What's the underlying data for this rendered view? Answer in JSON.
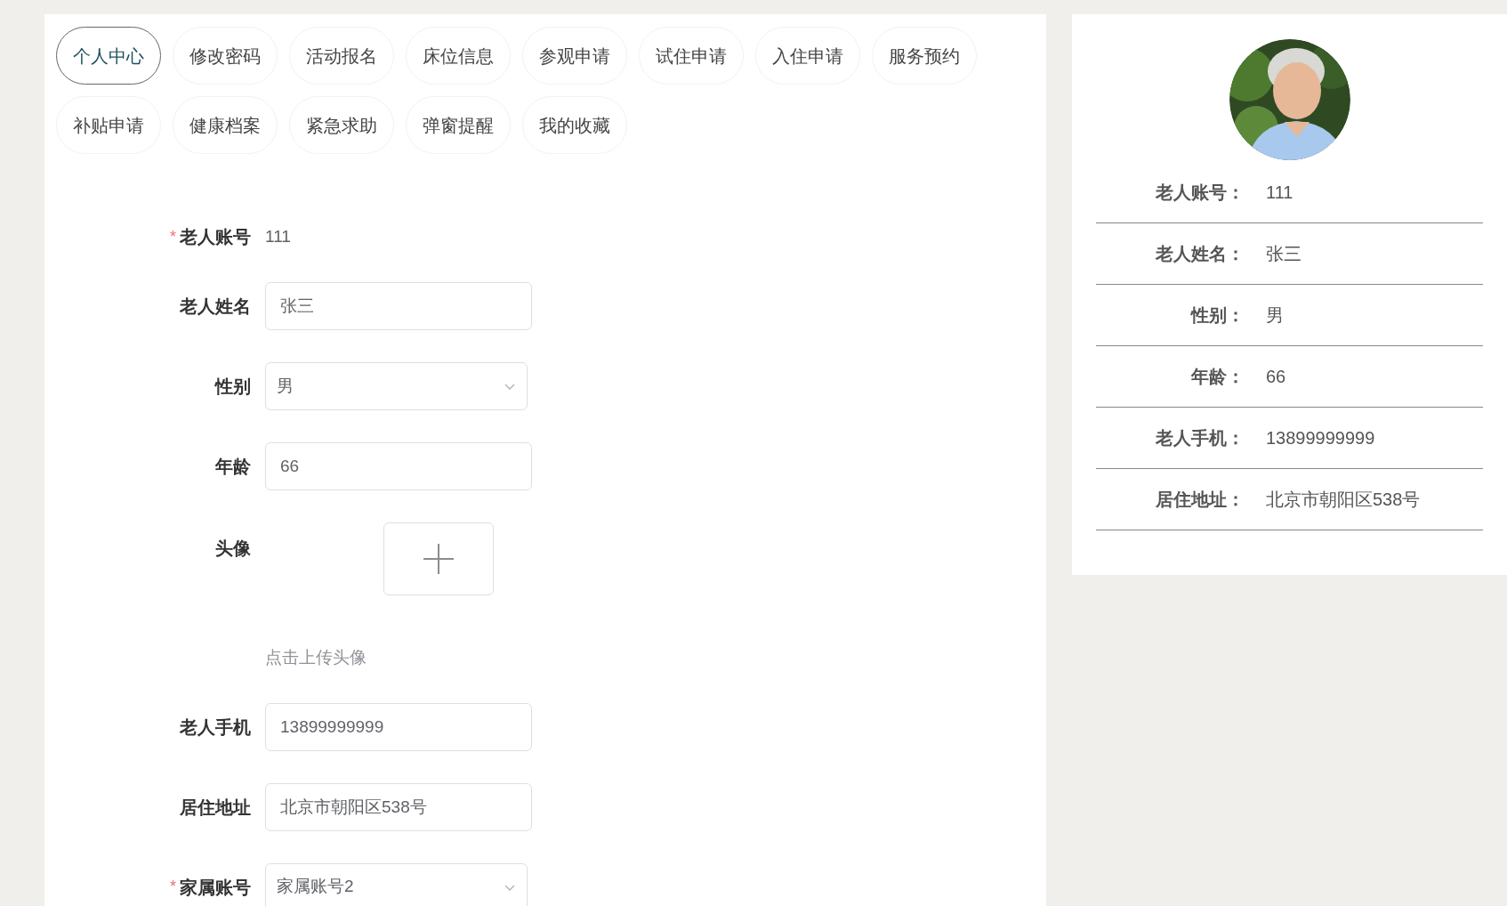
{
  "tabs": [
    {
      "label": "个人中心",
      "selected": true
    },
    {
      "label": "修改密码",
      "selected": false
    },
    {
      "label": "活动报名",
      "selected": false
    },
    {
      "label": "床位信息",
      "selected": false
    },
    {
      "label": "参观申请",
      "selected": false
    },
    {
      "label": "试住申请",
      "selected": false
    },
    {
      "label": "入住申请",
      "selected": false
    },
    {
      "label": "服务预约",
      "selected": false
    },
    {
      "label": "补贴申请",
      "selected": false
    },
    {
      "label": "健康档案",
      "selected": false
    },
    {
      "label": "紧急求助",
      "selected": false
    },
    {
      "label": "弹窗提醒",
      "selected": false
    },
    {
      "label": "我的收藏",
      "selected": false
    }
  ],
  "form": {
    "fields": [
      {
        "kind": "static",
        "label": "老人账号",
        "required_mark": "*",
        "value": "111"
      },
      {
        "kind": "input",
        "label": "老人姓名",
        "value": "张三"
      },
      {
        "kind": "select",
        "label": "性别",
        "value": "男"
      },
      {
        "kind": "input",
        "label": "年龄",
        "value": "66"
      },
      {
        "kind": "upload",
        "label": "头像",
        "hint": "点击上传头像"
      },
      {
        "kind": "input",
        "label": "老人手机",
        "value": "13899999999"
      },
      {
        "kind": "input",
        "label": "居住地址",
        "value": "北京市朝阳区538号"
      },
      {
        "kind": "select",
        "label": "家属账号",
        "required_mark": "*",
        "value": "家属账号2"
      }
    ]
  },
  "profile": {
    "rows": [
      {
        "label": "老人账号：",
        "value": "111"
      },
      {
        "label": "老人姓名：",
        "value": "张三"
      },
      {
        "label": "性别：",
        "value": "男"
      },
      {
        "label": "年龄：",
        "value": "66"
      },
      {
        "label": "老人手机：",
        "value": "13899999999"
      },
      {
        "label": "居住地址：",
        "value": "北京市朝阳区538号"
      }
    ]
  }
}
